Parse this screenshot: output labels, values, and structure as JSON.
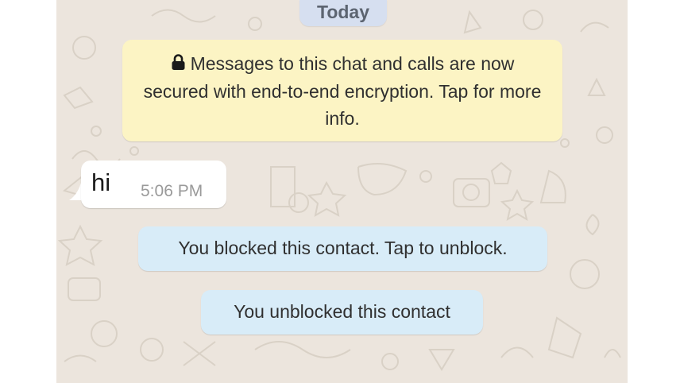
{
  "date_chip": {
    "label": "Today"
  },
  "encryption_notice": {
    "icon": "lock-icon",
    "text": "Messages to this chat and calls are now secured with end-to-end encryption. Tap for more info."
  },
  "messages": [
    {
      "direction": "incoming",
      "text": "hi",
      "time": "5:06 PM"
    }
  ],
  "system_messages": {
    "blocked": "You blocked this contact. Tap to unblock.",
    "unblocked": "You unblocked this contact"
  },
  "colors": {
    "chat_background": "#ece5dd",
    "date_chip": "#d6dff0",
    "encryption_notice": "#fcf4c4",
    "system_pill": "#d8ecf8",
    "incoming_bubble": "#ffffff"
  }
}
